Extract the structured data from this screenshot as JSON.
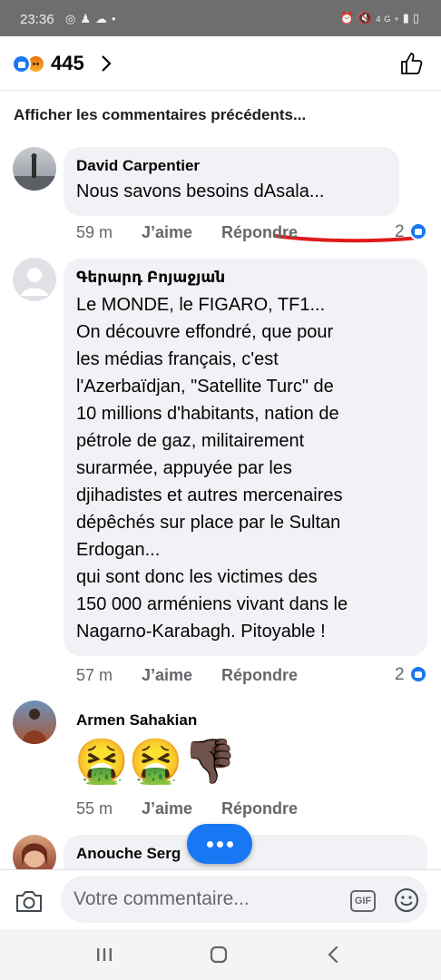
{
  "status_bar": {
    "time": "23:36",
    "left_icons": [
      "whatsapp-icon",
      "person-icon",
      "cloud-icon",
      "dot-icon"
    ],
    "right_icons": [
      "alarm-icon",
      "mute-icon",
      "signal-4g-icon",
      "battery-icon"
    ],
    "network": "4G+"
  },
  "reactions": {
    "count": "445",
    "types": [
      "like",
      "angry"
    ],
    "colors": {
      "like": "#1877f2",
      "angry": "#f7b125"
    }
  },
  "previous_comments_link": "Afficher les commentaires précédents...",
  "comments": [
    {
      "author": "David Carpentier",
      "lines": [
        "Nous savons besoins dAsala..."
      ],
      "time": "59 m",
      "like_label": "J’aime",
      "reply_label": "Répondre",
      "reaction_count": "2",
      "annotation": "red-underline"
    },
    {
      "author": "Գերարդ Բոյաջյան",
      "lines": [
        "Le MONDE, le FIGARO, TF1...",
        "On découvre effondré, que pour",
        "les médias français, c'est",
        "l'Azerbaïdjan, \"Satellite Turc\" de",
        "10 millions d'habitants, nation de",
        "pétrole de gaz, militairement",
        "surarmée, appuyée par les",
        "djihadistes et autres mercenaires",
        "dépêchés sur place par le Sultan",
        "Erdogan...",
        "qui sont donc les victimes des",
        "150 000 arméniens vivant dans le",
        "Nagarno-Karabagh. Pitoyable !"
      ],
      "time": "57 m",
      "like_label": "J’aime",
      "reply_label": "Répondre",
      "reaction_count": "2"
    },
    {
      "author": "Armen Sahakian",
      "emojis": [
        "🤮",
        "🤮",
        "👎🏿"
      ],
      "time": "55 m",
      "like_label": "J’aime",
      "reply_label": "Répondre"
    },
    {
      "author": "Anouche Serg"
    }
  ],
  "composer": {
    "placeholder": "Votre commentaire...",
    "gif_label": "GIF",
    "icons": [
      "camera-icon",
      "gif-icon",
      "smiley-icon"
    ]
  },
  "nav_bar": {
    "items": [
      "recents-icon",
      "home-icon",
      "back-icon"
    ]
  }
}
